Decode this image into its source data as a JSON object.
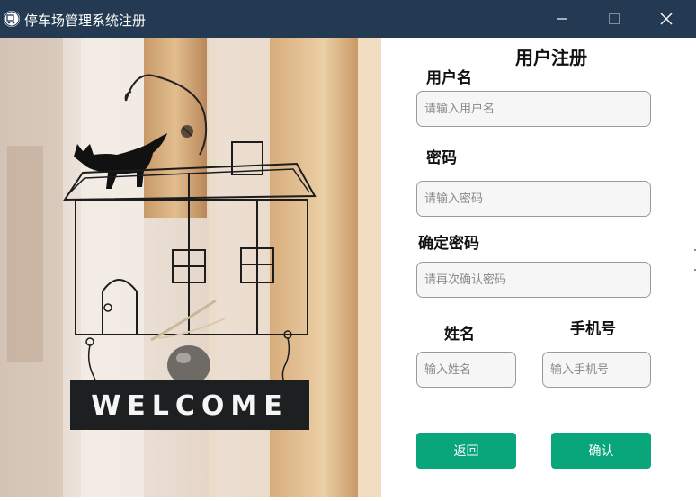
{
  "window": {
    "title": "停车场管理系统注册",
    "app_icon": "parking-app-icon",
    "controls": [
      "minimize-icon",
      "maximize-icon",
      "close-icon"
    ],
    "titlebar_color": "#243a52"
  },
  "illustration": {
    "sign_text": "WELCOME"
  },
  "form": {
    "heading": "用户注册",
    "username": {
      "label": "用户名",
      "placeholder": "请输入用户名",
      "value": ""
    },
    "password": {
      "label": "密码",
      "placeholder": "请输入密码",
      "value": ""
    },
    "confirm_password": {
      "label": "确定密码",
      "placeholder": "请再次确认密码",
      "value": ""
    },
    "name": {
      "label": "姓名",
      "placeholder": "输入姓名",
      "value": ""
    },
    "phone": {
      "label": "手机号",
      "placeholder": "输入手机号",
      "value": ""
    },
    "back_button": "返回",
    "confirm_button": "确认",
    "button_color": "#08a67a"
  }
}
